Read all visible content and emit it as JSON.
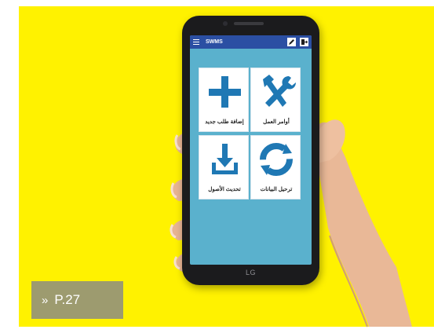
{
  "app": {
    "title": "SWMS",
    "icons": {
      "menu": "hamburger-menu-icon",
      "edit": "pencil-edit-icon",
      "logout": "logout-door-icon"
    }
  },
  "tiles": [
    {
      "label": "إضافة طلب جديد",
      "icon": "plus-icon"
    },
    {
      "label": "أوامر العمل",
      "icon": "hammer-wrench-icon"
    },
    {
      "label": "تحديث الأصول",
      "icon": "download-icon"
    },
    {
      "label": "ترحيل البيانات",
      "icon": "sync-icon"
    }
  ],
  "phone": {
    "brand": "LG"
  },
  "page_ref": {
    "chevron": "»",
    "text": "P.27"
  },
  "colors": {
    "background": "#fff200",
    "app_bar": "#2b4fa3",
    "screen": "#5ab1cd",
    "icon_blue": "#1f78b4",
    "page_ref_box": "#878787"
  }
}
